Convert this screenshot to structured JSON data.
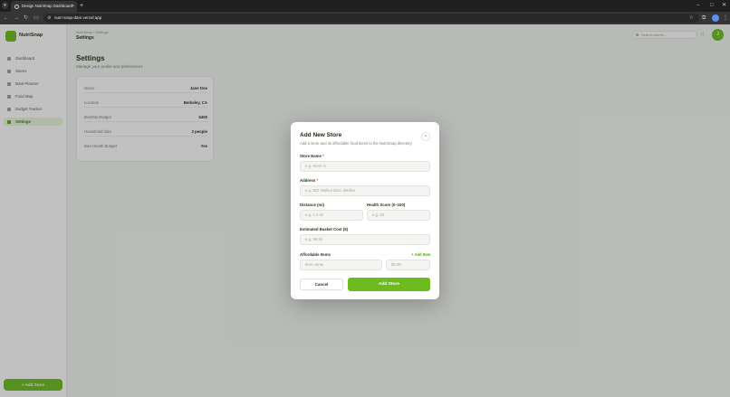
{
  "browser": {
    "tab_title": "Design NutriSnap Dashboard",
    "tab_close": "×",
    "new_tab": "+",
    "url": "nutri-snap-dam.vercel.app",
    "back": "←",
    "forward": "→",
    "reload": "↻",
    "minimize": "–",
    "maximize": "□",
    "close": "✕"
  },
  "sidebar": {
    "brand": "NutriSnap",
    "items": [
      {
        "label": "Dashboard"
      },
      {
        "label": "Stores"
      },
      {
        "label": "Meal Planner"
      },
      {
        "label": "Food Map"
      },
      {
        "label": "Budget Tracker"
      },
      {
        "label": "Settings"
      }
    ],
    "add_store": "+ Add Store"
  },
  "header": {
    "breadcrumb": "NutriSnap / Settings",
    "section": "Settings",
    "search_placeholder": "Search stores...",
    "avatar_initial": "J"
  },
  "settings": {
    "title": "Settings",
    "subtitle": "Manage your profile and preferences",
    "rows": [
      {
        "label": "Name",
        "value": "Jane Doe"
      },
      {
        "label": "Location",
        "value": "Berkeley, CA"
      },
      {
        "label": "Monthly Budget",
        "value": "$400"
      },
      {
        "label": "Household Size",
        "value": "2 people"
      },
      {
        "label": "Diet Health Budget",
        "value": "Yes"
      }
    ]
  },
  "modal": {
    "title": "Add New Store",
    "subtitle": "Add a store and its affordable food items to the NutriSnap directory.",
    "close": "×",
    "store_name_label": "Store Name",
    "store_name_placeholder": "e.g. Store X",
    "address_label": "Address",
    "address_placeholder": "e.g. 802 Walnut Blvd, Midline",
    "required_mark": " *",
    "distance_label": "Distance (mi)",
    "distance_placeholder": "e.g. 1.2 mi",
    "health_label": "Health Score (0–100)",
    "health_placeholder": "e.g. 82",
    "basket_label": "Estimated Basket Cost ($)",
    "basket_placeholder": "e.g. 38.50",
    "items_label": "Affordable Items",
    "add_item": "+ Add Item",
    "item_name_placeholder": "Item name",
    "item_price_placeholder": "$0.00",
    "cancel": "Cancel",
    "submit": "Add Store"
  }
}
